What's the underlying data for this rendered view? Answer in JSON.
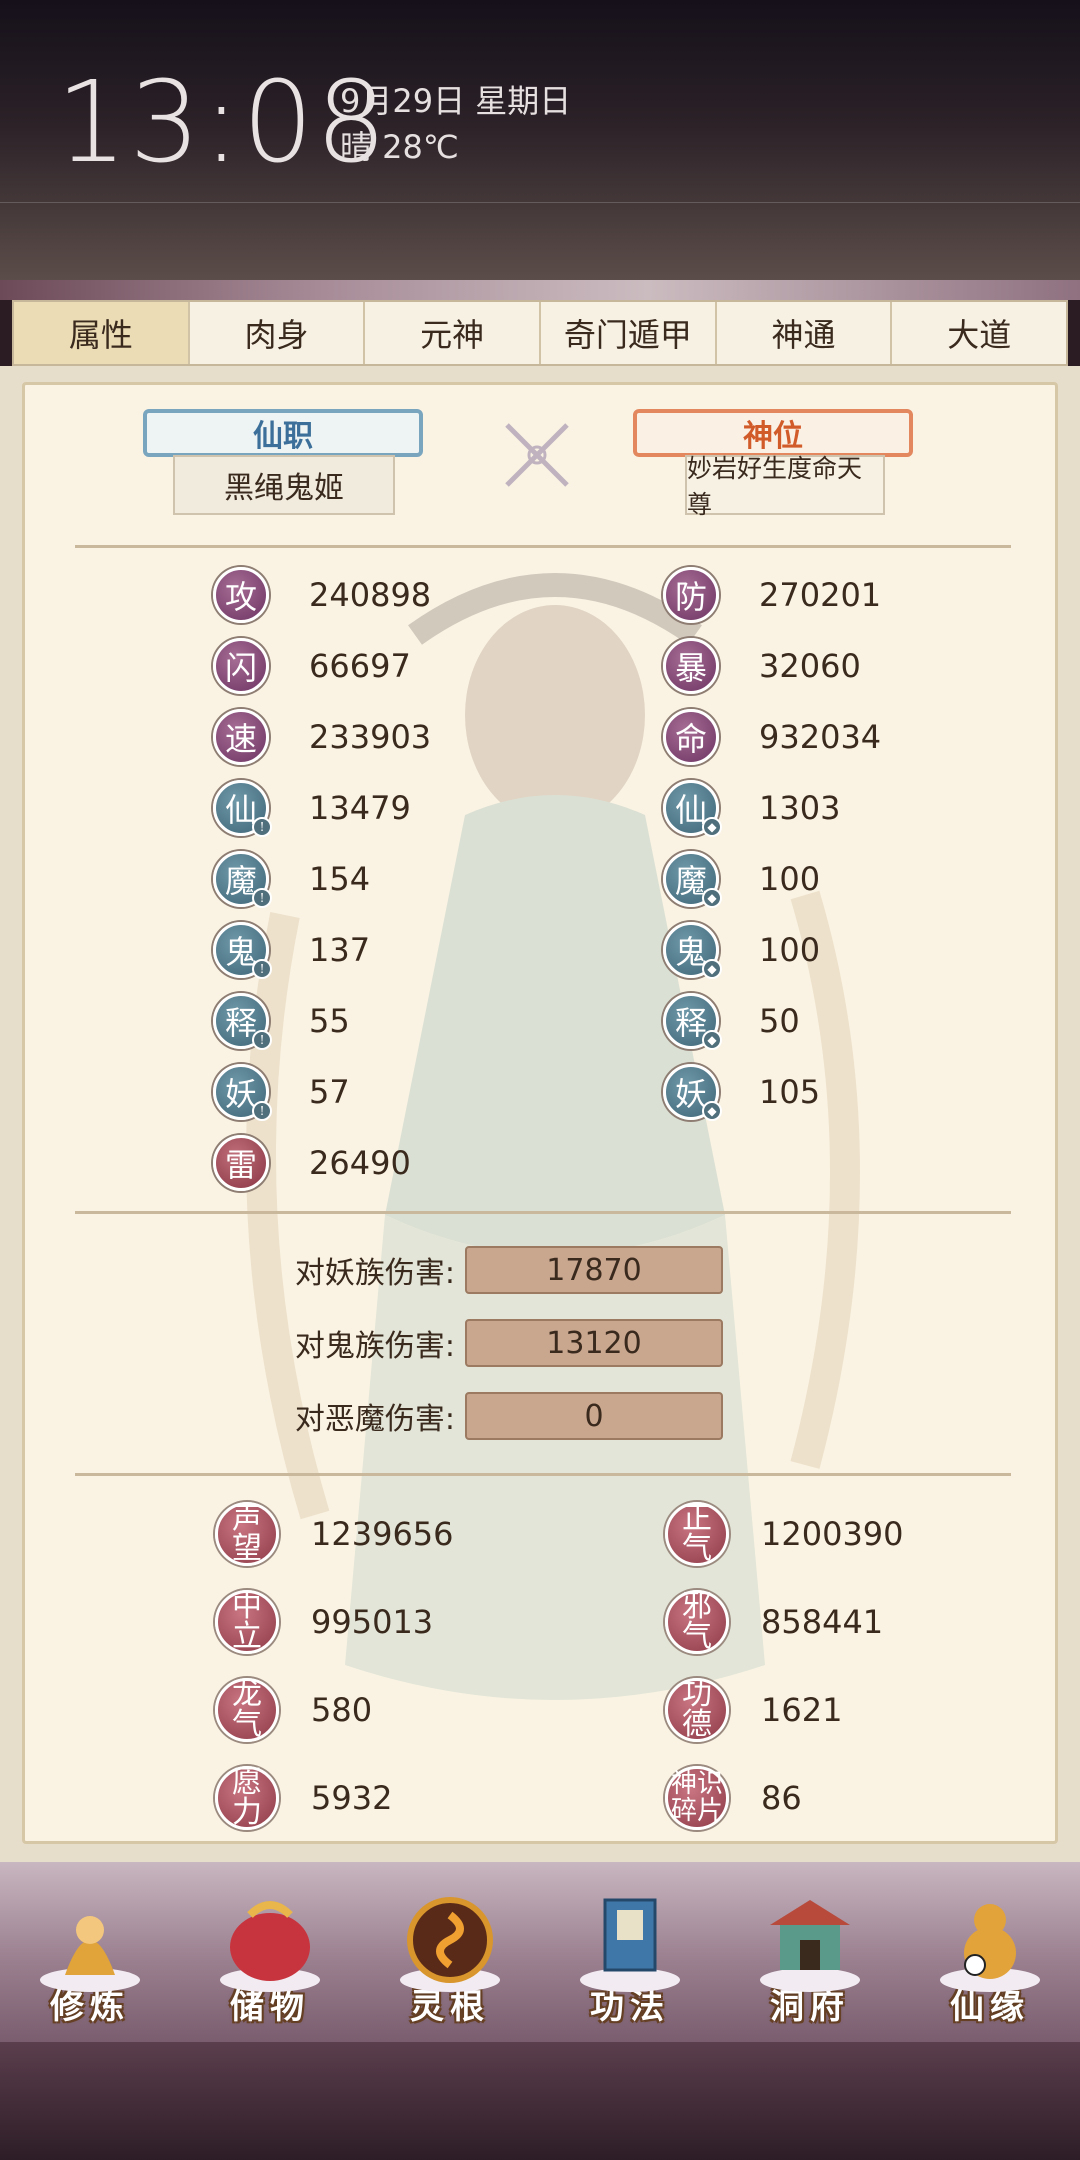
{
  "status": {
    "clock": "13:08",
    "date": "9月29日 星期日",
    "weather": "晴 28℃"
  },
  "tabs": [
    {
      "label": "属性",
      "active": true
    },
    {
      "label": "肉身",
      "active": false
    },
    {
      "label": "元神",
      "active": false
    },
    {
      "label": "奇门遁甲",
      "active": false
    },
    {
      "label": "神通",
      "active": false
    },
    {
      "label": "大道",
      "active": false
    }
  ],
  "titles": {
    "xianzhi_label": "仙职",
    "xianzhi_value": "黑绳鬼姬",
    "shenwei_label": "神位",
    "shenwei_value": "妙岩好生度命天尊"
  },
  "stats_left": [
    {
      "glyph": "攻",
      "value": "240898",
      "color": "purple"
    },
    {
      "glyph": "闪",
      "value": "66697",
      "color": "purple"
    },
    {
      "glyph": "速",
      "value": "233903",
      "color": "purple"
    },
    {
      "glyph": "仙",
      "value": "13479",
      "color": "teal"
    },
    {
      "glyph": "魔",
      "value": "154",
      "color": "teal"
    },
    {
      "glyph": "鬼",
      "value": "137",
      "color": "teal"
    },
    {
      "glyph": "释",
      "value": "55",
      "color": "teal"
    },
    {
      "glyph": "妖",
      "value": "57",
      "color": "teal"
    },
    {
      "glyph": "雷",
      "value": "26490",
      "color": "red"
    }
  ],
  "stats_right": [
    {
      "glyph": "防",
      "value": "270201",
      "color": "purple"
    },
    {
      "glyph": "暴",
      "value": "32060",
      "color": "purple"
    },
    {
      "glyph": "命",
      "value": "932034",
      "color": "purple"
    },
    {
      "glyph": "仙",
      "value": "1303",
      "color": "teal"
    },
    {
      "glyph": "魔",
      "value": "100",
      "color": "teal"
    },
    {
      "glyph": "鬼",
      "value": "100",
      "color": "teal"
    },
    {
      "glyph": "释",
      "value": "50",
      "color": "teal"
    },
    {
      "glyph": "妖",
      "value": "105",
      "color": "teal"
    }
  ],
  "damage": [
    {
      "label": "对妖族伤害:",
      "value": "17870"
    },
    {
      "label": "对鬼族伤害:",
      "value": "13120"
    },
    {
      "label": "对恶魔伤害:",
      "value": "0"
    }
  ],
  "reputation_left": [
    {
      "label": "声望",
      "value": "1239656"
    },
    {
      "label": "中立",
      "value": "995013"
    },
    {
      "label": "龙气",
      "value": "580"
    },
    {
      "label": "愿力",
      "value": "5932"
    }
  ],
  "reputation_right": [
    {
      "label": "正气",
      "value": "1200390"
    },
    {
      "label": "邪气",
      "value": "858441"
    },
    {
      "label": "功德",
      "value": "1621"
    },
    {
      "label": "神识碎片",
      "line1": "神识",
      "line2": "碎片",
      "value": "86"
    }
  ],
  "bottom_nav": [
    {
      "label": "修炼",
      "icon": "monk-icon"
    },
    {
      "label": "储物",
      "icon": "bag-icon"
    },
    {
      "label": "灵根",
      "icon": "swirl-orb-icon"
    },
    {
      "label": "功法",
      "icon": "book-icon"
    },
    {
      "label": "洞府",
      "icon": "pavilion-icon"
    },
    {
      "label": "仙缘",
      "icon": "gourd-icon"
    }
  ],
  "colors": {
    "panel_bg": "#faf3e3",
    "accent_blue": "#7aa5bf",
    "accent_orange": "#e2875e",
    "stat_purple": "#6e3463",
    "stat_teal": "#3e6678",
    "rep_red": "#8e3a47"
  }
}
